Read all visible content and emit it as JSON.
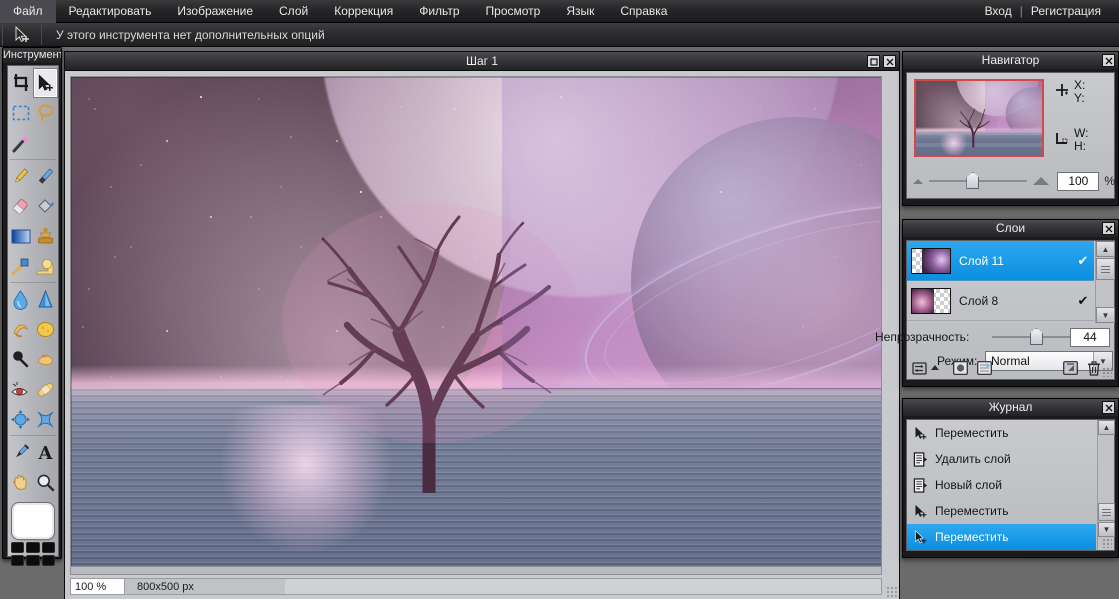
{
  "menu": {
    "items": [
      "Файл",
      "Редактировать",
      "Изображение",
      "Слой",
      "Коррекция",
      "Фильтр",
      "Просмотр",
      "Язык",
      "Справка"
    ],
    "login": "Вход",
    "separator": "|",
    "register": "Регистрация"
  },
  "options": {
    "tool_icon": "move-tool-icon",
    "hint": "У этого инструмента нет дополнительных опций"
  },
  "toolbox": {
    "title": "Инструменты",
    "tools": [
      {
        "name": "crop-tool",
        "selected": false
      },
      {
        "name": "move-tool",
        "selected": true
      },
      {
        "name": "rectangular-marquee-tool",
        "selected": false
      },
      {
        "name": "lasso-tool",
        "selected": false
      },
      {
        "name": "magic-wand-tool",
        "selected": false
      },
      {
        "name": "pencil-tool",
        "selected": false
      },
      {
        "name": "brush-tool",
        "selected": false
      },
      {
        "name": "eraser-tool",
        "selected": false
      },
      {
        "name": "paint-bucket-tool",
        "selected": false
      },
      {
        "name": "gradient-tool",
        "selected": false
      },
      {
        "name": "clone-stamp-tool",
        "selected": false
      },
      {
        "name": "healing-brush-tool",
        "selected": false
      },
      {
        "name": "pattern-stamp-tool",
        "selected": false
      },
      {
        "name": "blur-tool",
        "selected": false
      },
      {
        "name": "sharpen-tool",
        "selected": false
      },
      {
        "name": "smudge-tool",
        "selected": false
      },
      {
        "name": "sponge-tool",
        "selected": false
      },
      {
        "name": "dodge-tool",
        "selected": false
      },
      {
        "name": "burn-tool",
        "selected": false
      },
      {
        "name": "red-eye-tool",
        "selected": false
      },
      {
        "name": "bandaid-tool",
        "selected": false
      },
      {
        "name": "bloat-tool",
        "selected": false
      },
      {
        "name": "pinch-tool",
        "selected": false
      },
      {
        "name": "eyedropper-tool",
        "selected": false
      },
      {
        "name": "text-tool",
        "selected": false
      },
      {
        "name": "hand-tool",
        "selected": false
      },
      {
        "name": "zoom-tool",
        "selected": false
      }
    ],
    "foreground_color": "#ffffff",
    "palette_color": "#0c0c0c",
    "palette_cells": 6
  },
  "document": {
    "title": "Шаг 1",
    "maximize_icon": "maximize-icon",
    "close_icon": "close-icon",
    "status": {
      "zoom": "100 %",
      "size": "800x500 px"
    }
  },
  "navigator": {
    "title": "Навигатор",
    "close_icon": "close-icon",
    "pointer_icon": "crosshair-icon",
    "x_label": "X:",
    "y_label": "Y:",
    "bounds_icon": "bounds-icon",
    "w_label": "W:",
    "h_label": "H:",
    "zoom_out_icon": "zoom-out-icon",
    "zoom_in_icon": "zoom-in-icon",
    "zoom_value": "100",
    "zoom_unit": "%"
  },
  "layers": {
    "title": "Слои",
    "close_icon": "close-icon",
    "items": [
      {
        "name": "Слой 11",
        "visible": true,
        "checkmark": "✔",
        "active": true
      },
      {
        "name": "Слой 8",
        "visible": true,
        "checkmark": "✔",
        "active": false
      }
    ],
    "opacity_label": "Непрозрачность:",
    "opacity_value": "44",
    "mode_label": "Режим:",
    "mode_value": "Normal",
    "mode_options": [
      "Normal"
    ],
    "toolbar": [
      {
        "name": "link-layers-button",
        "icon": "link-icon"
      },
      {
        "name": "layer-style-button",
        "icon": "circle-icon"
      },
      {
        "name": "add-mask-button",
        "icon": "mask-icon"
      },
      {
        "name": "new-layer-button",
        "icon": "new-layer-icon"
      },
      {
        "name": "delete-layer-button",
        "icon": "trash-icon"
      }
    ],
    "scroll_up_icon": "chevron-up-icon",
    "scroll_down_icon": "chevron-down-icon"
  },
  "history": {
    "title": "Журнал",
    "close_icon": "close-icon",
    "items": [
      {
        "name": "Переместить",
        "icon": "move-icon",
        "active": false
      },
      {
        "name": "Удалить слой",
        "icon": "layer-icon",
        "active": false
      },
      {
        "name": "Новый слой",
        "icon": "layer-icon",
        "active": false
      },
      {
        "name": "Переместить",
        "icon": "move-icon",
        "active": false
      },
      {
        "name": "Переместить",
        "icon": "move-icon",
        "active": true
      }
    ],
    "scroll_up_icon": "chevron-up-icon",
    "scroll_down_icon": "chevron-down-icon"
  },
  "colors": {
    "accent": "#0a8fe0",
    "panel_bg": "#1b1b1d",
    "panel_face": "#c8cacd",
    "menu_bg": "#242426",
    "app_bg": "#6b6b6b",
    "nav_frame": "#d04a4a"
  }
}
